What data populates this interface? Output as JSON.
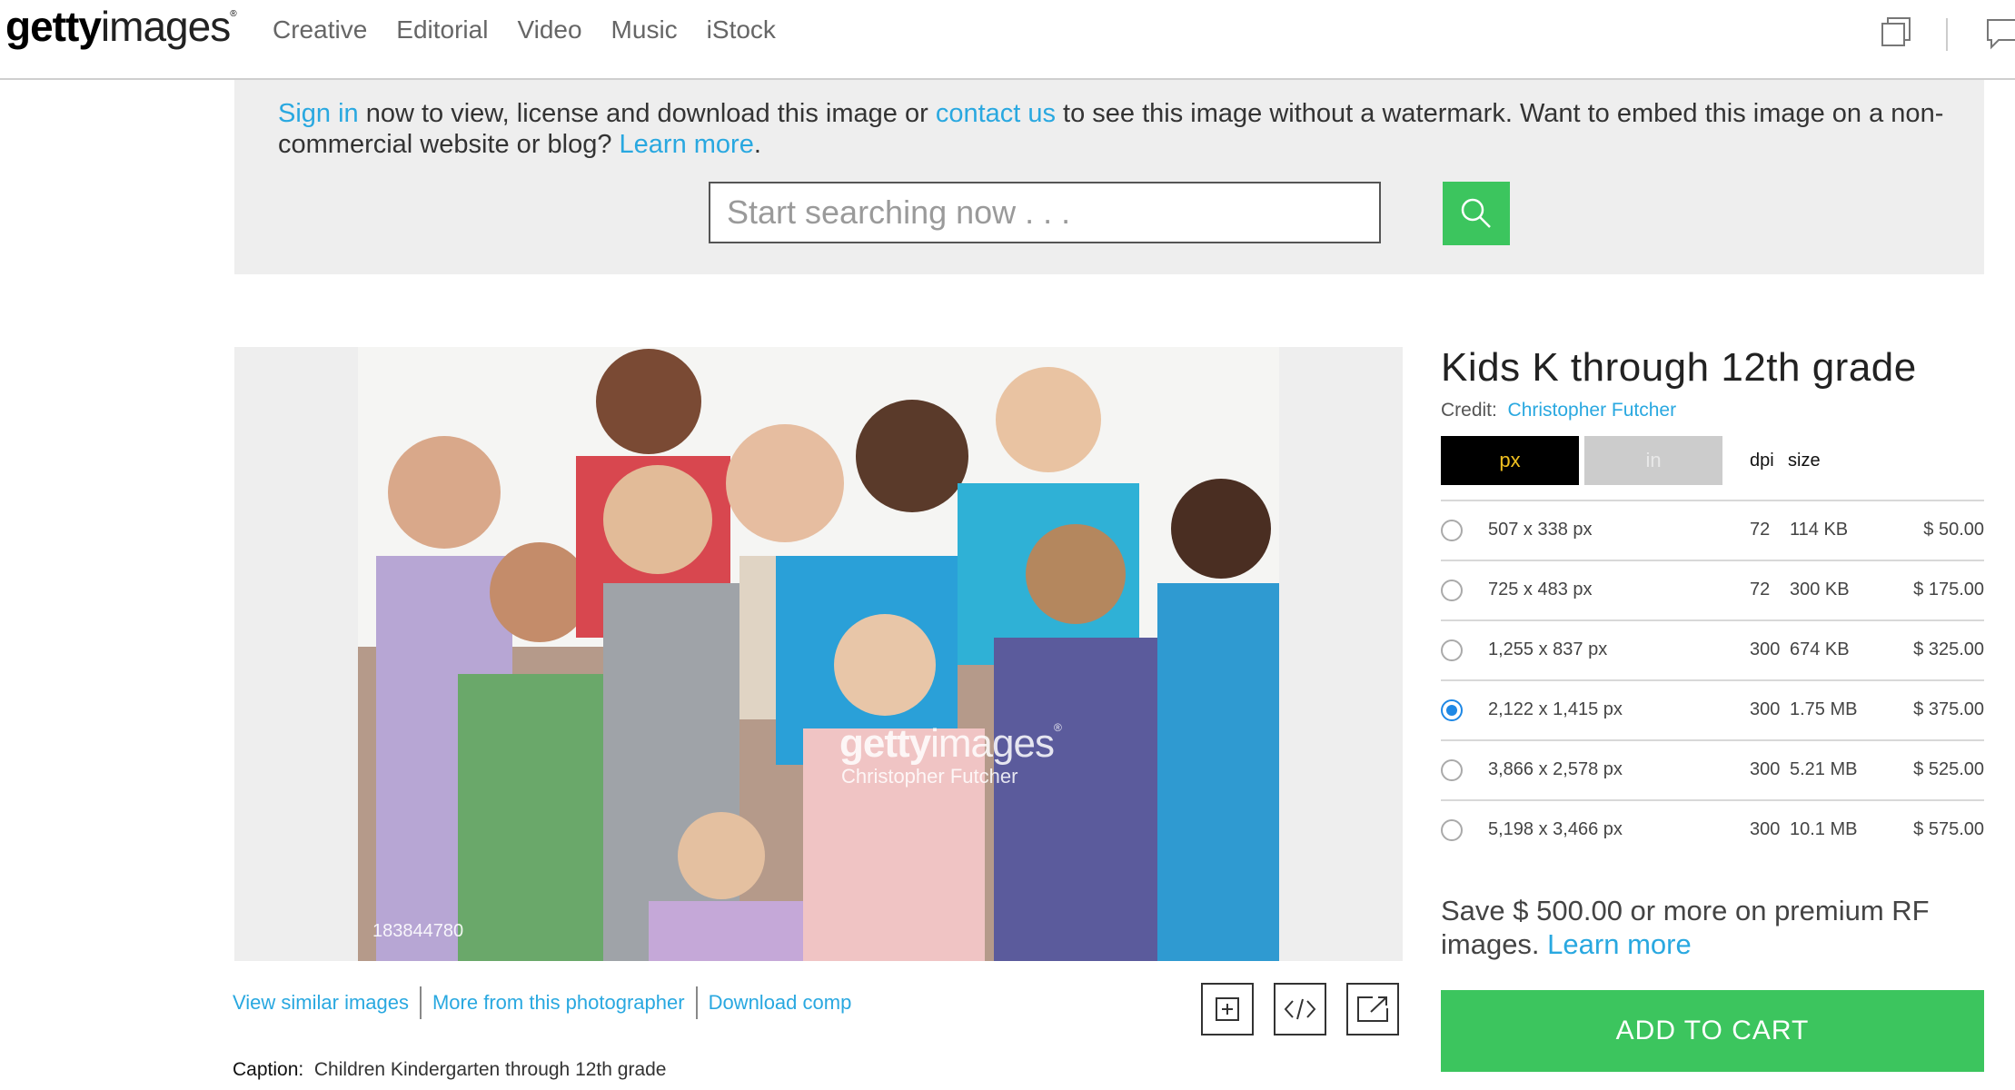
{
  "logo": {
    "bold": "getty",
    "light": "images",
    "mark": "®"
  },
  "nav": [
    "Creative",
    "Editorial",
    "Video",
    "Music",
    "iStock"
  ],
  "banner": {
    "sign_in": "Sign in",
    "text1": " now to view, license and download this image or ",
    "contact": "contact us",
    "text2": " to see this image without a watermark. Want to embed this image on a non-commercial website or blog? ",
    "learn_more": "Learn more",
    "text3": "."
  },
  "search": {
    "placeholder": "Start searching now . . ."
  },
  "image": {
    "watermark_bold": "getty",
    "watermark_light": "images",
    "watermark_mark": "®",
    "watermark_credit": "Christopher Futcher",
    "id": "183844780"
  },
  "image_links": [
    "View similar images",
    "More from this photographer",
    "Download comp"
  ],
  "caption": {
    "label": "Caption:",
    "text": "Children Kindergarten through 12th grade"
  },
  "detail": {
    "title": "Kids K through 12th grade",
    "credit_label": "Credit:",
    "credit_name": "Christopher Futcher",
    "tab_px": "px",
    "tab_in": "in",
    "col_dpi": "dpi",
    "col_size": "size"
  },
  "sizes": [
    {
      "dims": "507 x 338 px",
      "dpi": "72",
      "size": "114 KB",
      "price": "$ 50.00",
      "selected": false
    },
    {
      "dims": "725 x 483 px",
      "dpi": "72",
      "size": "300 KB",
      "price": "$ 175.00",
      "selected": false
    },
    {
      "dims": "1,255 x 837 px",
      "dpi": "300",
      "size": "674 KB",
      "price": "$ 325.00",
      "selected": false
    },
    {
      "dims": "2,122 x 1,415 px",
      "dpi": "300",
      "size": "1.75 MB",
      "price": "$ 375.00",
      "selected": true
    },
    {
      "dims": "3,866 x 2,578 px",
      "dpi": "300",
      "size": "5.21 MB",
      "price": "$ 525.00",
      "selected": false
    },
    {
      "dims": "5,198 x 3,466 px",
      "dpi": "300",
      "size": "10.1 MB",
      "price": "$ 575.00",
      "selected": false
    }
  ],
  "save": {
    "text": "Save $ 500.00 or more on premium RF images. ",
    "link": "Learn more"
  },
  "cart": {
    "label": "ADD TO CART"
  },
  "colors": {
    "link": "#29a8e0",
    "cta": "#3cc55e",
    "selected": "#1e88e5"
  }
}
